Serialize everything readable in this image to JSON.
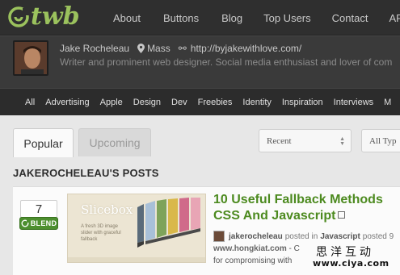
{
  "brand": {
    "logo_text": "twb",
    "accent": "#9bc25d"
  },
  "topnav": [
    "About",
    "Buttons",
    "Blog",
    "Top Users",
    "Contact",
    "API"
  ],
  "profile": {
    "name": "Jake Rocheleau",
    "location": "Mass",
    "website": "http://byjakewithlove.com/",
    "bio": "Writer and prominent web designer. Social media enthusiast and lover of com"
  },
  "categories": [
    "All",
    "Advertising",
    "Apple",
    "Design",
    "Dev",
    "Freebies",
    "Identity",
    "Inspiration",
    "Interviews",
    "M"
  ],
  "tabs": {
    "popular": "Popular",
    "upcoming": "Upcoming"
  },
  "selects": {
    "sort": "Recent",
    "type": "All Typ"
  },
  "posts_heading": "JAKEROCHELEAU'S POSTS",
  "post": {
    "votes": "7",
    "blend_label": "BLEND",
    "thumb_title": "Slicebox",
    "thumb_subtitle": "A fresh 3D image slider with graceful fallback",
    "title": "10 Useful Fallback Methods CSS And Javascript",
    "author": "jakerocheleau",
    "posted_in": "posted in",
    "category": "Javascript",
    "time": "posted 9",
    "domain": "www.hongkiat.com",
    "domain_suffix": "- C",
    "excerpt": "for compromising with"
  },
  "watermark": {
    "cn": "思洋互动",
    "url": "www.ciya.com"
  },
  "colors": {
    "blend_green": "#4d8f2f",
    "title_green": "#4c8a1f"
  }
}
